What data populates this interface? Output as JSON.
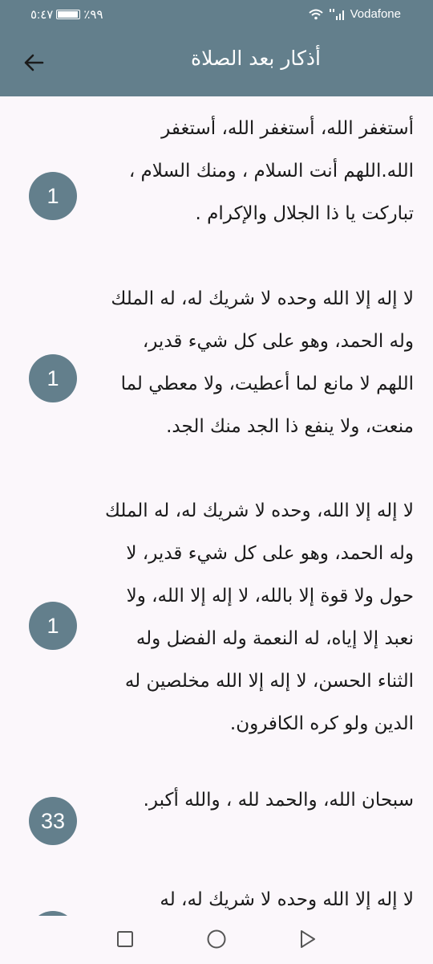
{
  "status_bar": {
    "time": "٥:٤٧",
    "battery": "٪٩٩",
    "carrier": "Vodafone",
    "signal_label": "ll"
  },
  "header": {
    "title": "أذكار بعد الصلاة",
    "back_icon": "arrow-left-icon"
  },
  "azkar": [
    {
      "text": "أستغفر الله، أستغفر الله، أستغفر الله.اللهم أنت السلام ، ومنك السلام ، تباركت يا ذا الجلال والإكرام .",
      "count": "1"
    },
    {
      "text": "لا إله إلا الله وحده لا شريك له، له الملك وله الحمد، وهو على كل شيء قدير، اللهم لا مانع لما أعطيت، ولا معطي لما منعت، ولا ينفع ذا الجد منك الجد.",
      "count": "1"
    },
    {
      "text": "لا إله إلا الله، وحده لا شريك له، له الملك وله الحمد، وهو على كل شيء قدير، لا حول ولا قوة إلا بالله، لا إله إلا الله، ولا نعبد إلا إياه، له النعمة وله الفضل وله الثناء الحسن، لا إله إلا الله مخلصين له الدين ولو كره الكافرون.",
      "count": "1"
    },
    {
      "text": "سبحان الله، والحمد لله ، والله أكبر.",
      "count": "33"
    },
    {
      "text": "لا إله إلا الله وحده لا شريك له، له",
      "count": ""
    }
  ],
  "nav": {
    "recents_icon": "square-icon",
    "home_icon": "circle-icon",
    "back_icon": "triangle-back-icon"
  },
  "colors": {
    "primary": "#637f8c",
    "background": "#fbf7fb",
    "text": "#1a1a1a"
  }
}
